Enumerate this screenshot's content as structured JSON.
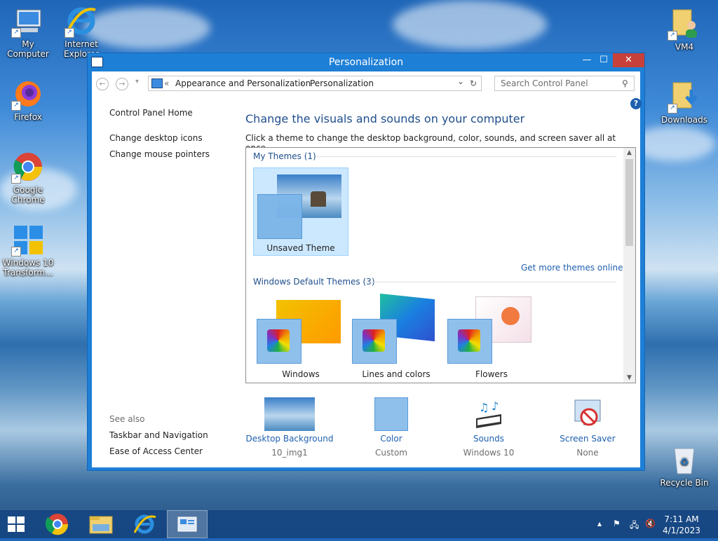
{
  "desktop": {
    "icons": [
      {
        "label": "My Computer"
      },
      {
        "label": "Internet Explorer"
      },
      {
        "label": "Firefox"
      },
      {
        "label": "Google Chrome"
      },
      {
        "label": "Windows 10 Transform..."
      },
      {
        "label": "VM4"
      },
      {
        "label": "Downloads"
      },
      {
        "label": "Recycle Bin"
      }
    ]
  },
  "window": {
    "title": "Personalization",
    "minimize": "—",
    "maximize": "☐",
    "close": "✕"
  },
  "address": {
    "back": "←",
    "forward": "→",
    "overflow": "«",
    "crumbs": [
      "Appearance and Personalization",
      "Personalization"
    ],
    "separator": "›",
    "refresh": "↻",
    "dropdown": "⌄",
    "search_placeholder": "Search Control Panel"
  },
  "left_pane": {
    "home": "Control Panel Home",
    "links": [
      "Change desktop icons",
      "Change mouse pointers"
    ],
    "see_also_title": "See also",
    "see_also": [
      "Taskbar and Navigation",
      "Ease of Access Center"
    ]
  },
  "main": {
    "heading": "Change the visuals and sounds on your computer",
    "subheading": "Click a theme to change the desktop background, color, sounds, and screen saver all at once.",
    "my_themes_title": "My Themes (1)",
    "my_themes": [
      {
        "name": "Unsaved Theme"
      }
    ],
    "more_themes_link": "Get more themes online",
    "default_themes_title": "Windows Default Themes (3)",
    "default_themes": [
      {
        "name": "Windows"
      },
      {
        "name": "Lines and colors"
      },
      {
        "name": "Flowers"
      }
    ],
    "help": "?"
  },
  "bottom": [
    {
      "label": "Desktop Background",
      "value": "10_img1"
    },
    {
      "label": "Color",
      "value": "Custom"
    },
    {
      "label": "Sounds",
      "value": "Windows 10"
    },
    {
      "label": "Screen Saver",
      "value": "None"
    }
  ],
  "taskbar": {
    "time": "7:11 AM",
    "date": "4/1/2023"
  },
  "colors": {
    "accent": "#1e7fd6",
    "link": "#1e5fae",
    "heading": "#1e4e8c",
    "close": "#c7403a"
  }
}
